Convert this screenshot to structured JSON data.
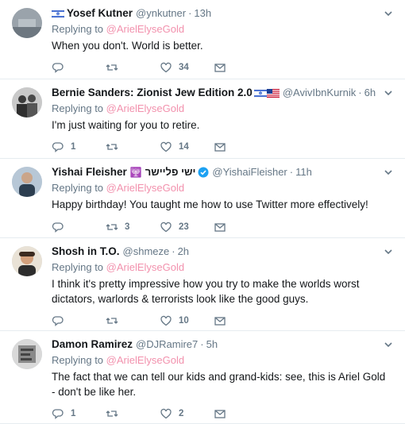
{
  "replying_prefix": "Replying to",
  "tweets": [
    {
      "name": "Yosef Kutner",
      "handle": "@ynkutner",
      "time": "13h",
      "reply_to": "@ArielElyseGold",
      "text": "When you don't. World is better.",
      "replies": "",
      "retweets": "",
      "likes": "34"
    },
    {
      "name": "Bernie Sanders: Zionist Jew Edition 2.0",
      "handle": "@AvivIbnKurnik",
      "time": "6h",
      "reply_to": "@ArielElyseGold",
      "text": "I'm just waiting for you to retire.",
      "replies": "1",
      "retweets": "",
      "likes": "14"
    },
    {
      "name": "Yishai Fleisher",
      "name_heb": "ישי פליישר",
      "handle": "@YishaiFleisher",
      "time": "11h",
      "reply_to": "@ArielElyseGold",
      "text": "Happy birthday! You taught me how to use Twitter more effectively!",
      "replies": "",
      "retweets": "3",
      "likes": "23"
    },
    {
      "name": "Shosh in T.O.",
      "handle": "@shmeze",
      "time": "2h",
      "reply_to": "@ArielElyseGold",
      "text": "I think it's pretty impressive how you try to make the worlds worst dictators, warlords & terrorists look like the good guys.",
      "replies": "",
      "retweets": "",
      "likes": "10"
    },
    {
      "name": "Damon Ramirez",
      "handle": "@DJRamire7",
      "time": "5h",
      "reply_to": "@ArielElyseGold",
      "text": "The fact that we can tell our kids and grand-kids: see, this is Ariel Gold - don't be like her.",
      "replies": "1",
      "retweets": "",
      "likes": "2"
    }
  ]
}
